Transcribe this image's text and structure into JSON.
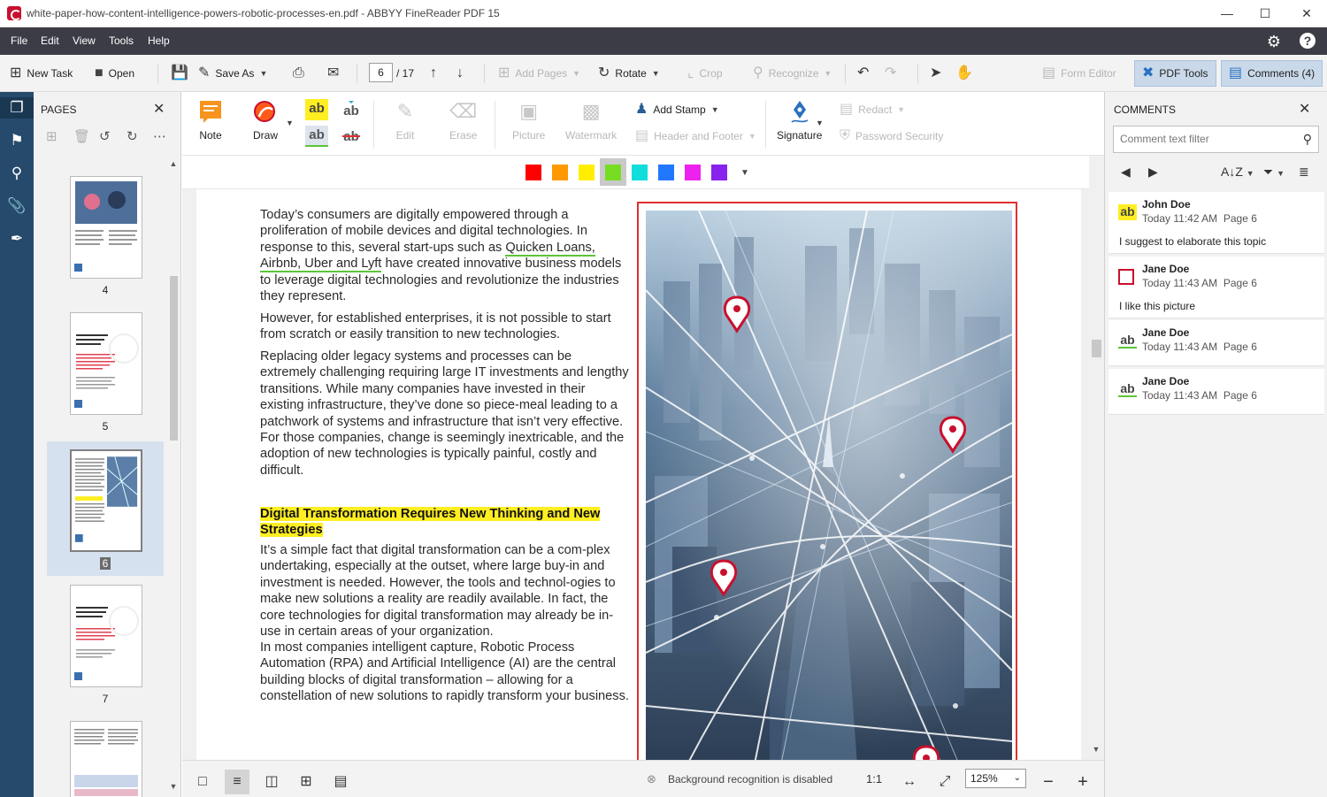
{
  "window": {
    "title": "white-paper-how-content-intelligence-powers-robotic-processes-en.pdf - ABBYY FineReader PDF 15"
  },
  "menu": [
    "File",
    "Edit",
    "View",
    "Tools",
    "Help"
  ],
  "toolbar": {
    "new_task": "New Task",
    "open": "Open",
    "save_as": "Save As",
    "page_current": "6",
    "page_total": "/ 17",
    "add_pages": "Add Pages",
    "rotate": "Rotate",
    "crop": "Crop",
    "recognize": "Recognize",
    "form_editor": "Form Editor",
    "pdf_tools": "PDF Tools",
    "comments": "Comments (4)"
  },
  "pages_panel": {
    "title": "PAGES",
    "thumbnails": [
      {
        "label": "4",
        "selected": false
      },
      {
        "label": "5",
        "selected": false
      },
      {
        "label": "6",
        "selected": true
      },
      {
        "label": "7",
        "selected": false
      }
    ]
  },
  "ribbon": {
    "note": "Note",
    "draw": "Draw",
    "edit": "Edit",
    "erase": "Erase",
    "picture": "Picture",
    "watermark": "Watermark",
    "add_stamp": "Add Stamp",
    "header_footer": "Header and Footer",
    "signature": "Signature",
    "redact": "Redact",
    "password_security": "Password Security",
    "highlight_text": "ab"
  },
  "colors": {
    "swatches": [
      "#ff0000",
      "#ff9900",
      "#ffee00",
      "#77dd22",
      "#11dddd",
      "#2277ff",
      "#ee22ee",
      "#8822ee"
    ],
    "selected": "#77dd22",
    "accent": "#264a6c",
    "highlight": "#ffee22",
    "frame": "#e03030"
  },
  "document": {
    "paragraphs": [
      "Today’s consumers are digitally empowered through a proliferation of mobile devices and digital technologies. In response to this, several start-ups such as",
      "Quicken Loans, Airbnb, Uber and Lyft",
      "have created innovative business models to leverage digital technologies and revolutionize the industries they represent.",
      "However, for established enterprises, it is not possible to start from scratch or easily transition to new technologies.",
      "Replacing older legacy systems and processes can be extremely challenging requiring large IT investments and lengthy transitions. While many companies have invested in their existing infrastructure, they’ve done so piece-meal leading to a patchwork of systems and infrastructure that isn’t very effective. For those companies, change is seemingly inextricable, and the adoption of new technologies is typically painful, costly and difficult.",
      "Digital Transformation Requires New Thinking and New Strategies",
      "It’s a simple fact that digital transformation can be a com-plex undertaking, especially at the outset, where large buy-in and investment is needed. However, the tools and technol-ogies to make new solutions a reality are readily available. In fact, the core technologies for digital transformation may already be in-use in certain areas of your organization.",
      "In most companies intelligent capture, Robotic Process Automation (RPA) and Artificial Intelligence (AI) are the central building blocks of digital transformation – allowing for a constellation of new solutions to rapidly transform your business."
    ]
  },
  "status": {
    "background_recognition": "Background recognition is disabled",
    "ratio": "1:1",
    "zoom": "125%"
  },
  "comments_panel": {
    "title": "COMMENTS",
    "filter_placeholder": "Comment text filter",
    "comments": [
      {
        "author": "John Doe",
        "time": "Today 11:42 AM",
        "page": "Page 6",
        "text": "I suggest to elaborate this topic",
        "icon": "highlight-icon"
      },
      {
        "author": "Jane Doe",
        "time": "Today 11:43 AM",
        "page": "Page 6",
        "text": "I like this picture",
        "icon": "rectangle-icon"
      },
      {
        "author": "Jane Doe",
        "time": "Today 11:43 AM",
        "page": "Page 6",
        "text": "",
        "icon": "underline-icon"
      },
      {
        "author": "Jane Doe",
        "time": "Today 11:43 AM",
        "page": "Page 6",
        "text": "",
        "icon": "underline-icon"
      }
    ]
  }
}
